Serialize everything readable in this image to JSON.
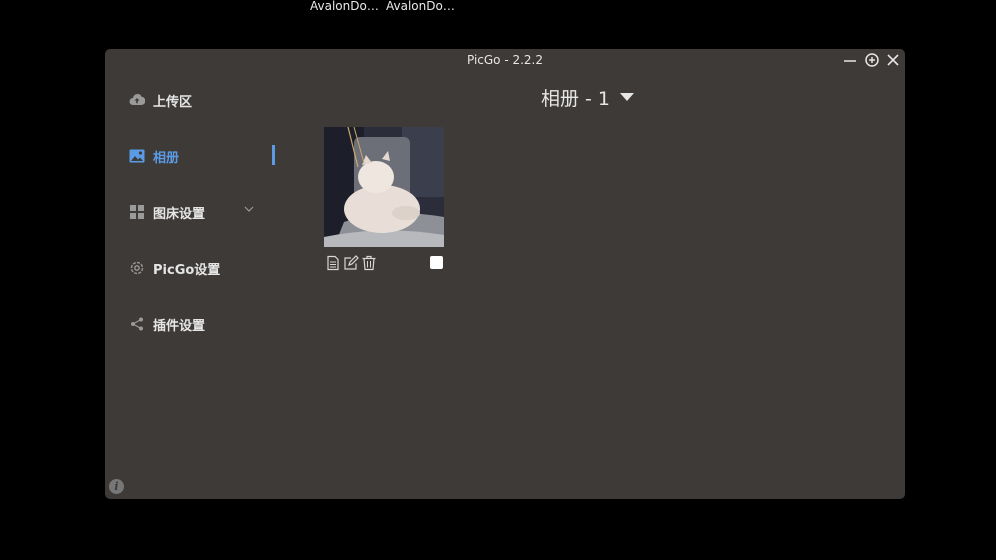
{
  "taskbar": {
    "labels": [
      "AvalonDo…",
      "AvalonDo…"
    ]
  },
  "window": {
    "title": "PicGo - 2.2.2"
  },
  "sidebar": {
    "items": [
      {
        "label": "上传区",
        "icon": "cloud-upload-icon"
      },
      {
        "label": "相册",
        "icon": "image-icon",
        "active": true
      },
      {
        "label": "图床设置",
        "icon": "grid-icon",
        "expandable": true
      },
      {
        "label": "PicGo设置",
        "icon": "gear-icon"
      },
      {
        "label": "插件设置",
        "icon": "share-icon"
      }
    ]
  },
  "gallery": {
    "title": "相册 - 1",
    "images": [
      {
        "alt": "cat photo",
        "actions": [
          "copy-link-icon",
          "edit-icon",
          "delete-icon"
        ],
        "checked": false
      }
    ]
  },
  "colors": {
    "accent": "#5b9be6",
    "window_bg": "#3e3a37"
  }
}
